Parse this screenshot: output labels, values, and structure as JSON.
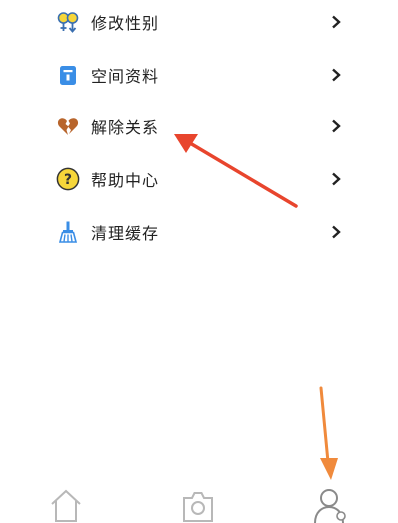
{
  "menu": {
    "items": [
      {
        "label": "修改性别",
        "icon": "gender-icon"
      },
      {
        "label": "空间资料",
        "icon": "profile-card-icon"
      },
      {
        "label": "解除关系",
        "icon": "broken-heart-icon"
      },
      {
        "label": "帮助中心",
        "icon": "help-icon"
      },
      {
        "label": "清理缓存",
        "icon": "broom-icon"
      }
    ]
  },
  "tabbar": {
    "tabs": [
      {
        "icon": "home-icon"
      },
      {
        "icon": "camera-icon"
      },
      {
        "icon": "profile-icon",
        "active": true
      }
    ]
  },
  "colors": {
    "annotation_red": "#e8452d",
    "annotation_orange": "#f08a3c",
    "icon_blue": "#3a8ee6",
    "help_yellow": "#f6d63a",
    "heart_brown": "#b8652c",
    "tab_gray": "#b8b8b8"
  }
}
